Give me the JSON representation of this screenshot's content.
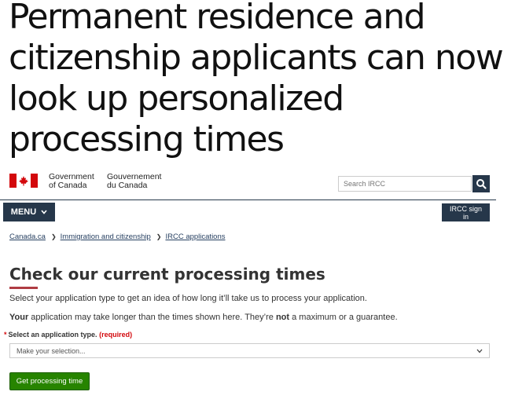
{
  "headline": "Permanent residence and citizenship applicants can now look up personalized processing times",
  "header": {
    "signature_en_line1": "Government",
    "signature_en_line2": "of Canada",
    "signature_fr_line1": "Gouvernement",
    "signature_fr_line2": "du Canada",
    "search_placeholder": "Search IRCC",
    "search_icon": "magnifier-icon",
    "flag_color": "#d3080c",
    "brand_color": "#26374a"
  },
  "nav": {
    "menu_label": "MENU",
    "signin_label": "IRCC sign in"
  },
  "breadcrumb": [
    "Canada.ca",
    "Immigration and citizenship",
    "IRCC applications"
  ],
  "main": {
    "title": "Check our current processing times",
    "intro": "Select your application type to get an idea of how long it’ll take us to process your application.",
    "caveat_bold1": "Your",
    "caveat_text1": " application may take longer than the times shown here. They’re ",
    "caveat_bold2": "not",
    "caveat_text2": " a maximum or a guarantee.",
    "field_label": "Select an application type.",
    "field_required": "(required)",
    "select_value": "Make your selection...",
    "submit_label": "Get processing time",
    "submit_color": "#278400"
  }
}
